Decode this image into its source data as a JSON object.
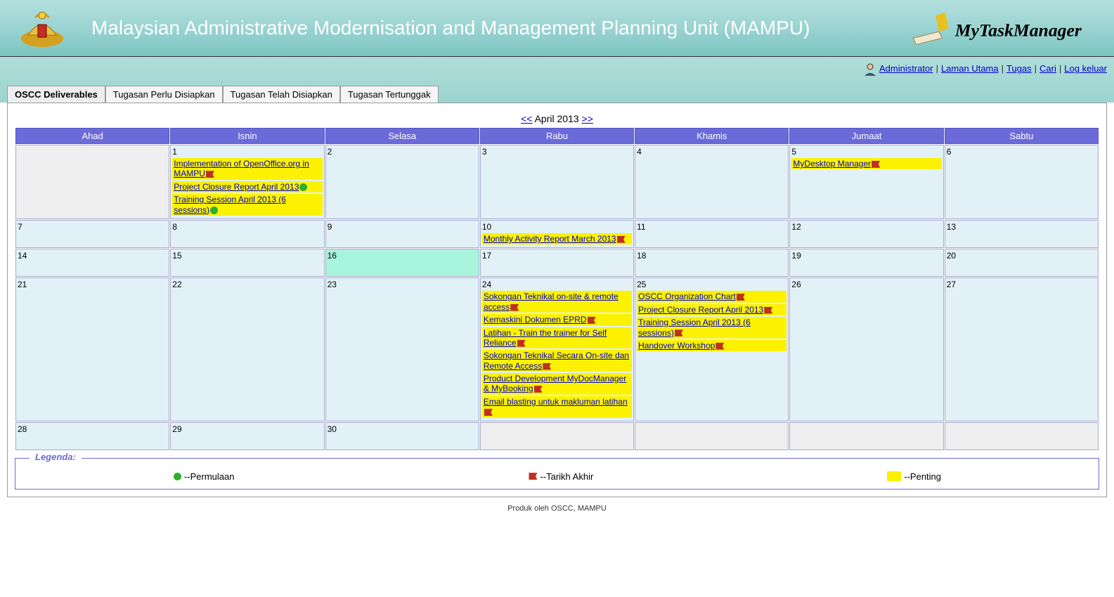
{
  "header": {
    "title": "Malaysian Administrative Modernisation and Management Planning Unit (MAMPU)",
    "logo_my": "My",
    "logo_task": "TaskManager"
  },
  "nav": {
    "links": [
      "Administrator",
      "Laman Utama",
      "Tugas",
      "Cari",
      "Log keluar"
    ]
  },
  "tabs": [
    {
      "label": "OSCC Deliverables",
      "active": true
    },
    {
      "label": "Tugasan Perlu Disiapkan",
      "active": false
    },
    {
      "label": "Tugasan Telah Disiapkan",
      "active": false
    },
    {
      "label": "Tugasan Tertunggak",
      "active": false
    }
  ],
  "calendar": {
    "month_label": "April 2013",
    "prev": "<<",
    "next": ">>",
    "days": [
      "Ahad",
      "Isnin",
      "Selasa",
      "Rabu",
      "Khamis",
      "Jumaat",
      "Sabtu"
    ],
    "today": 16,
    "weeks": [
      [
        {
          "n": "",
          "other": true
        },
        {
          "n": "1",
          "tasks": [
            {
              "t": "Implementation of OpenOffice.org in MAMPU",
              "f": "end"
            },
            {
              "t": "Project Closure Report April 2013",
              "f": "start"
            },
            {
              "t": "Training Session April 2013 (6 sessions)",
              "f": "start"
            }
          ]
        },
        {
          "n": "2"
        },
        {
          "n": "3"
        },
        {
          "n": "4"
        },
        {
          "n": "5",
          "tasks": [
            {
              "t": "MyDesktop Manager",
              "f": "end"
            }
          ]
        },
        {
          "n": "6"
        }
      ],
      [
        {
          "n": "7"
        },
        {
          "n": "8"
        },
        {
          "n": "9"
        },
        {
          "n": "10",
          "tasks": [
            {
              "t": "Monthly Activity Report March 2013",
              "f": "end"
            }
          ]
        },
        {
          "n": "11"
        },
        {
          "n": "12"
        },
        {
          "n": "13"
        }
      ],
      [
        {
          "n": "14"
        },
        {
          "n": "15"
        },
        {
          "n": "16",
          "today": true
        },
        {
          "n": "17"
        },
        {
          "n": "18"
        },
        {
          "n": "19"
        },
        {
          "n": "20"
        }
      ],
      [
        {
          "n": "21"
        },
        {
          "n": "22"
        },
        {
          "n": "23"
        },
        {
          "n": "24",
          "tasks": [
            {
              "t": "Sokongan Teknikal on-site & remote access",
              "f": "end"
            },
            {
              "t": "Kemaskini Dokumen EPRD",
              "f": "end"
            },
            {
              "t": "Latihan - Train the trainer for Self Reliance",
              "f": "end"
            },
            {
              "t": "Sokongan Teknikal Secara On-site dan Remote Access",
              "f": "end"
            },
            {
              "t": "Product Development MyDocManager & MyBooking",
              "f": "end"
            },
            {
              "t": "Email blasting untuk makluman latihan",
              "f": "end"
            }
          ]
        },
        {
          "n": "25",
          "tasks": [
            {
              "t": "OSCC Organization Chart",
              "f": "end"
            },
            {
              "t": "Project Closure Report April 2013",
              "f": "end"
            },
            {
              "t": "Training Session April 2013 (6 sessions)",
              "f": "end"
            },
            {
              "t": "Handover Workshop",
              "f": "end"
            }
          ]
        },
        {
          "n": "26"
        },
        {
          "n": "27"
        }
      ],
      [
        {
          "n": "28"
        },
        {
          "n": "29"
        },
        {
          "n": "30"
        },
        {
          "n": "",
          "other": true
        },
        {
          "n": "",
          "other": true
        },
        {
          "n": "",
          "other": true
        },
        {
          "n": "",
          "other": true
        }
      ]
    ]
  },
  "legend": {
    "title": "Legenda:",
    "items": [
      {
        "icon": "start",
        "label": "--Permulaan"
      },
      {
        "icon": "end",
        "label": "--Tarikh Akhir"
      },
      {
        "icon": "box",
        "label": "--Penting"
      }
    ]
  },
  "footer": "Produk oleh OSCC, MAMPU"
}
